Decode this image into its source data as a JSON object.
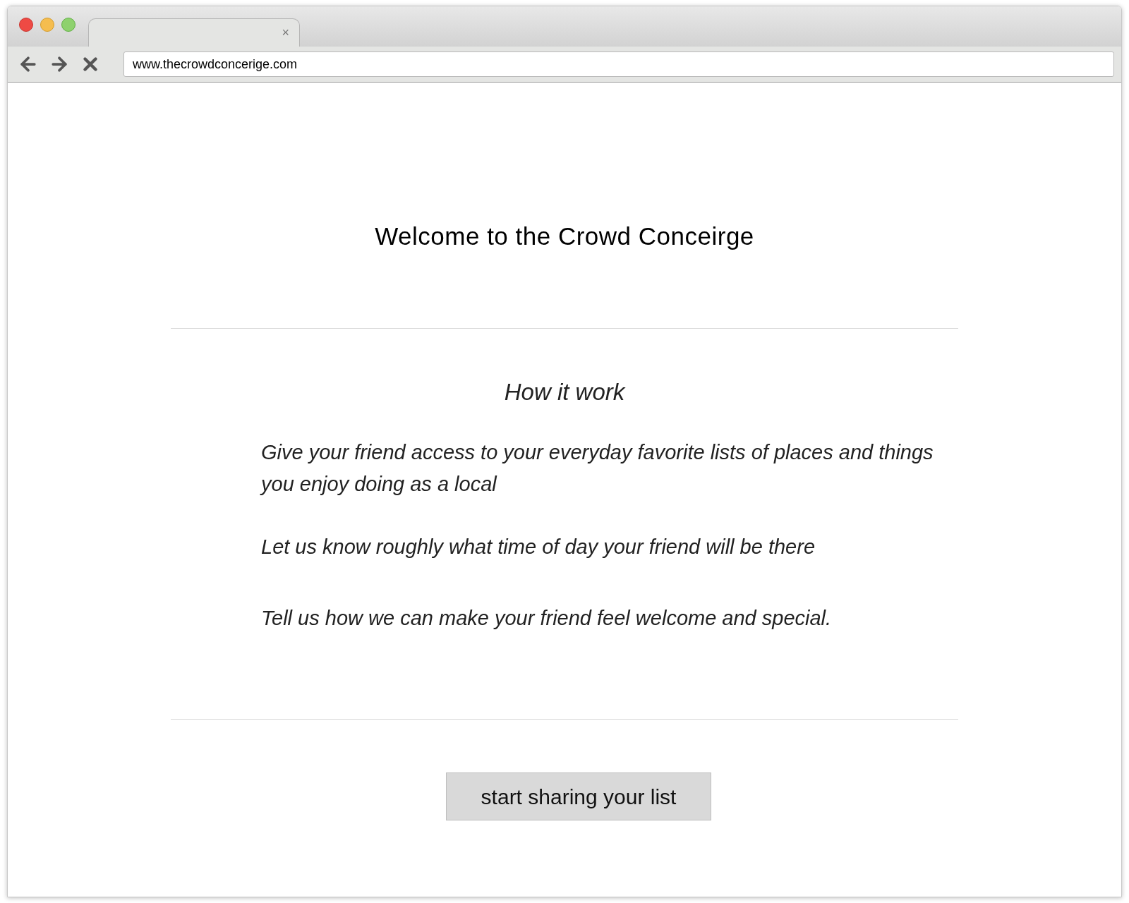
{
  "browser": {
    "tab_close": "×",
    "url": "www.thecrowdconcerige.com"
  },
  "heading": "Welcome to the Crowd Conceirge",
  "section_title": "How it work",
  "steps": [
    "Give your friend access to your everyday favorite lists of places and things you enjoy doing as a local",
    "Let us know roughly what time of day your friend will be there",
    "Tell us how we can make your friend feel welcome and special."
  ],
  "button": "start sharing your list"
}
